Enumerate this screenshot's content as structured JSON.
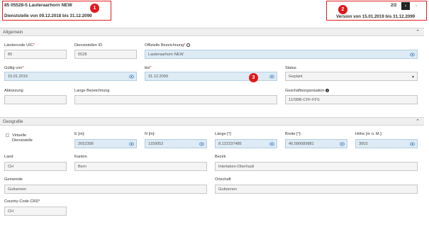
{
  "header": {
    "title": "85 05528-5 Lauteraarhorn NEW",
    "dienststelle_range": "Dienststelle von 09.12.2018 bis 31.12.2099",
    "pagination": "2/2",
    "version_range": "Version von 15.01.2019 bis 31.12.2099"
  },
  "badges": [
    "1",
    "2",
    "3"
  ],
  "allgemein": {
    "section_title": "Allgemein",
    "laendercode_label": "Ländercode UIC",
    "laendercode_value": "85",
    "dienststellen_id_label": "Dienststellen ID",
    "dienststellen_id_value": "5528",
    "offizielle_bezeichnung_label": "Offizielle Bezeichnung",
    "offizielle_bezeichnung_value": "Lauteraarhorn NEW",
    "gueltig_von_label": "Gültig von",
    "gueltig_von_value": "15.01.2019",
    "bis_label": "bis",
    "bis_value": "31.12.2099",
    "status_label": "Status",
    "status_value": "Geplant",
    "abkuerzung_label": "Abkürzung",
    "abkuerzung_value": "",
    "lange_bezeichnung_label": "Lange Bezeichnung",
    "lange_bezeichnung_value": "",
    "geschaeftsorganisation_label": "Geschäftsorganisation",
    "geschaeftsorganisation_value": "11/SBB-CFF-FFS"
  },
  "geografie": {
    "section_title": "Geografie",
    "virtuelle_label": "Virtuelle Dienststelle",
    "e_label": "E [m]:",
    "e_value": "2652398",
    "n_label": "N [m]:",
    "n_value": "1159052",
    "laenge_label": "Länge [°]:",
    "laenge_value": "8.122237485",
    "breite_label": "Breite [°]:",
    "breite_value": "46.580689881",
    "hoehe_label": "Höhe [m ü. M.]:",
    "hoehe_value": "3503",
    "land_label": "Land",
    "land_value": "CH",
    "kanton_label": "Kanton",
    "kanton_value": "Bern",
    "bezirk_label": "Bezirk",
    "bezirk_value": "Interlaken-Oberhasli",
    "gemeinde_label": "Gemeinde",
    "gemeinde_value": "Guttannen",
    "ortschaft_label": "Ortschaft",
    "ortschaft_value": "Guttannen",
    "country_code_label": "Country-Code CRD",
    "country_code_value": "CH"
  },
  "required_marker": "*",
  "colors": {
    "accent_field": "#ddebf5",
    "highlight": "#e02020",
    "badge": "#e0191b"
  },
  "icons": [
    "eye-icon",
    "chevron-up-icon",
    "chevron-left-icon",
    "chevron-right-icon",
    "info-icon",
    "caret-down-icon",
    "checkbox-icon"
  ]
}
